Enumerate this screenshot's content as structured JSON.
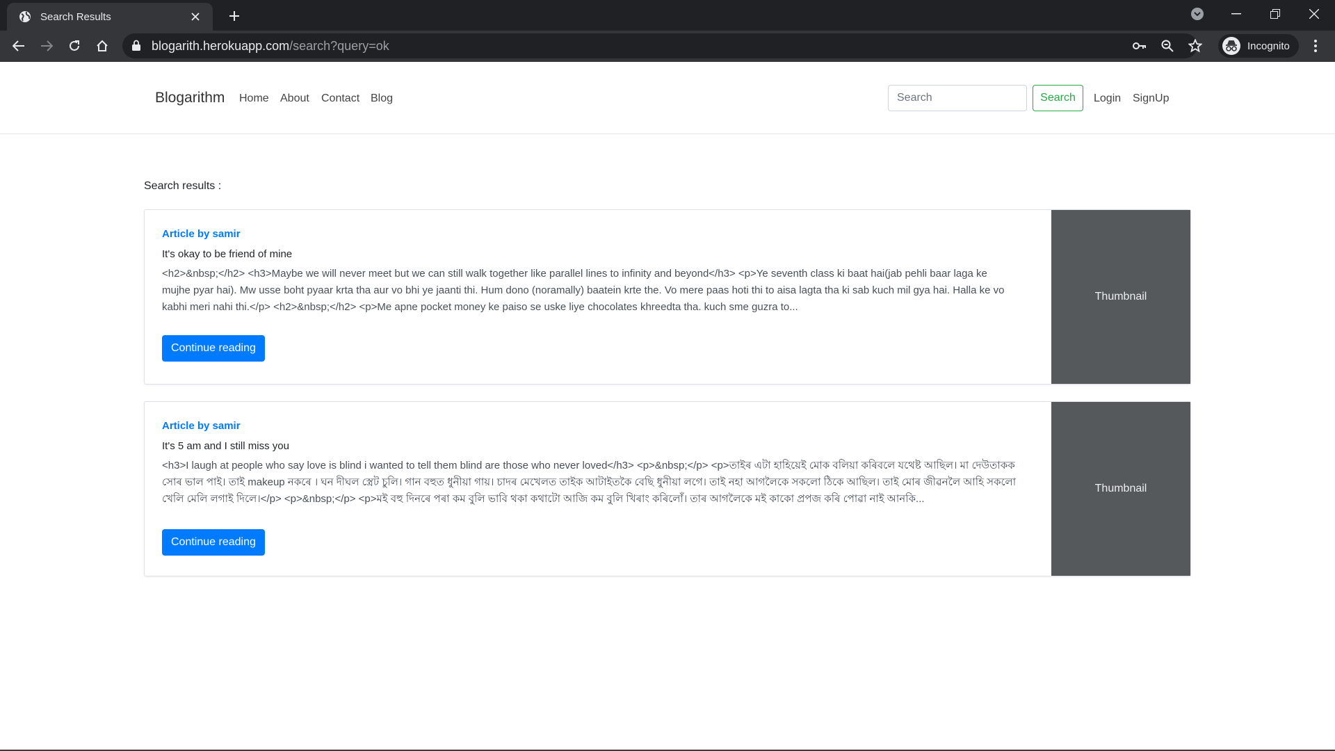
{
  "browser": {
    "tab_title": "Search Results",
    "url_host": "blogarith.herokuapp.com",
    "url_path": "/search?query=ok",
    "profile_label": "Incognito"
  },
  "navbar": {
    "brand": "Blogarithm",
    "links": [
      "Home",
      "About",
      "Contact",
      "Blog"
    ],
    "search_placeholder": "Search",
    "search_button": "Search",
    "login": "Login",
    "signup": "SignUp"
  },
  "main": {
    "results_heading": "Search results :",
    "articles": [
      {
        "author": "Article by samir",
        "title": "It's okay to be friend of mine",
        "excerpt": "<h2>&nbsp;</h2> <h3>Maybe we will never meet but we can still walk together like parallel lines to infinity and beyond</h3> <p>Ye seventh class ki baat hai(jab pehli baar laga ke mujhe pyar hai). Mw usse boht pyaar krta tha aur vo bhi ye jaanti thi. Hum dono (noramally) baatein krte the. Vo mere paas hoti thi to aisa lagta tha ki sab kuch mil gya hai. Halla ke vo kabhi meri nahi thi.</p> <h2>&nbsp;</h2> <p>Me apne pocket money ke paiso se uske liye chocolates khreedta tha. kuch sme guzra to...",
        "button": "Continue reading",
        "thumbnail": "Thumbnail"
      },
      {
        "author": "Article by samir",
        "title": "It's 5 am and I still miss you",
        "excerpt": "<h3>I laugh at people who say love is blind i wanted to tell them blind are those who never loved</h3> <p>&nbsp;</p> <p>তাইৰ এটা হাহিয়েই মোক বলিয়া কৰিবলে যথেষ্ট আছিল। মা দেউতাকক সোৰ ভাল পাই। তাই makeup নকৰে । ঘন দীঘল স্ত্রেট চুলি। গান বহুত ধুনীয়া গায়। চাদৰ মেখেলত তাইক আটাইতকৈ বেছি ধুনীয়া লগে। তাই নহা আগলৈকে সকলো ঠিকে আছিল। তাই মোৰ জীৱনলৈ আহি সকলো খেলি মেলি লগাই দিলে।</p> <p>&nbsp;</p> <p>মই বহু দিনৰে পৰা কম বুলি ভাবি থকা কথাটো আজি কম বুলি খিৰাং কৰিলোঁ। তাৰ আগলৈকে মই কাকো প্ৰপজ কৰি পোৱা নাই আনকি...",
        "button": "Continue reading",
        "thumbnail": "Thumbnail"
      }
    ]
  },
  "colors": {
    "primary": "#007bff",
    "success": "#28a745",
    "thumbnail_bg": "#55595c",
    "chrome_dark": "#202124",
    "chrome_toolbar": "#35363a"
  }
}
